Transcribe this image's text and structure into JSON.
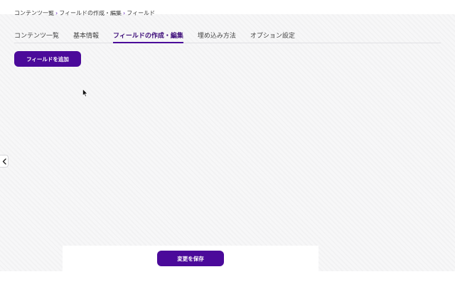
{
  "breadcrumb": {
    "items": [
      "コンテンツ一覧",
      "フィールドの作成・編集",
      "フィールド"
    ],
    "separator": "›"
  },
  "tabs": [
    {
      "label": "コンテンツ一覧",
      "active": false
    },
    {
      "label": "基本情報",
      "active": false
    },
    {
      "label": "フィールドの作成・編集",
      "active": true
    },
    {
      "label": "埋め込み方法",
      "active": false
    },
    {
      "label": "オプション設定",
      "active": false
    }
  ],
  "actions": {
    "add_field_label": "フィールドを追加",
    "save_label": "変更を保存"
  },
  "icons": {
    "sidebar_toggle": "chevron-left-icon",
    "cursor": "mouse-pointer-icon"
  },
  "colors": {
    "accent": "#4b0a9a",
    "active_tab_text": "#3b0a78"
  }
}
